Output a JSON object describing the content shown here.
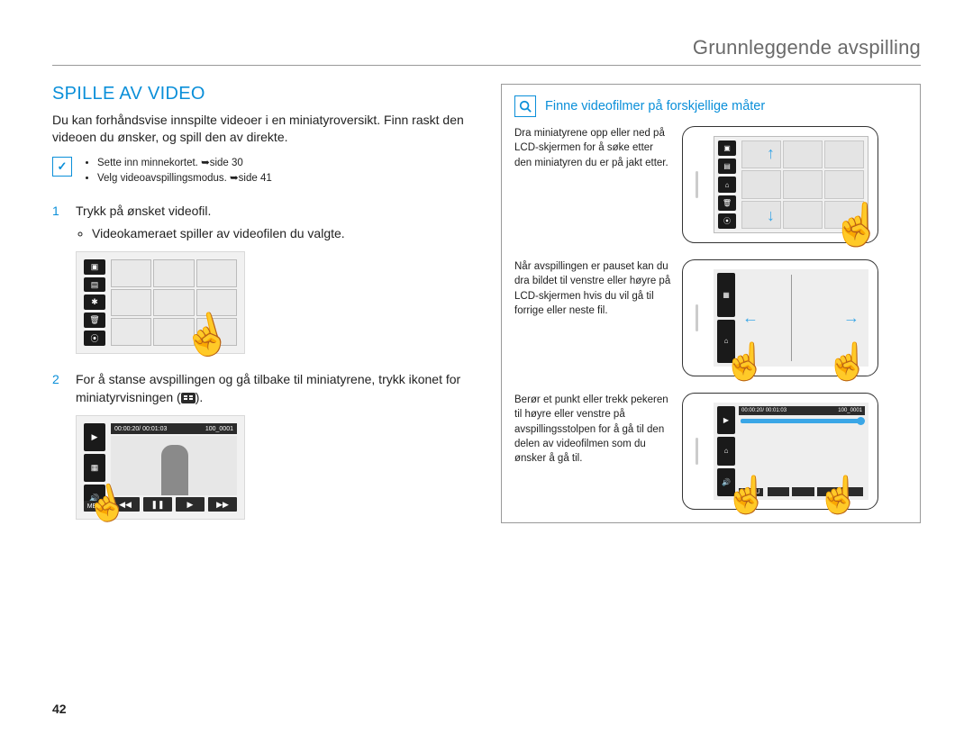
{
  "header": {
    "title": "Grunnleggende avspilling"
  },
  "section": {
    "title": "SPILLE AV VIDEO"
  },
  "intro": "Du kan forhåndsvise innspilte videoer i en miniatyroversikt. Finn raskt den videoen du ønsker, og spill den av direkte.",
  "notes": {
    "items": [
      {
        "pre": "Sette inn minnekortet. ",
        "arrow": "➥",
        "post": "side 30"
      },
      {
        "pre": "Velg videoavspillingsmodus. ",
        "arrow": "➥",
        "post": "side 41"
      }
    ]
  },
  "steps": [
    {
      "num": "1",
      "text": "Trykk på ønsket videofil.",
      "sub": [
        "Videokameraet spiller av videofilen du valgte."
      ]
    },
    {
      "num": "2",
      "text_a": "For å stanse avspillingen og gå tilbake til miniatyrene, trykk ikonet for miniatyrvisningen (",
      "text_b": ")."
    }
  ],
  "player": {
    "time": "00:00:20/ 00:01:03",
    "clip": "100_0001",
    "menu": "MENU",
    "controls": [
      "◀◀",
      "❚❚",
      "▶",
      "▶▶"
    ]
  },
  "sidebar_icons": [
    "▣",
    "▤",
    "✱",
    "🗑",
    "⦿"
  ],
  "info": {
    "title": "Finne videofilmer på forskjellige måter",
    "rows": [
      {
        "text": "Dra miniatyrene opp eller ned på LCD-skjermen for å søke etter den miniatyren du er på jakt etter."
      },
      {
        "text": "Når avspillingen er pauset kan du dra bildet til venstre eller høyre på LCD-skjermen hvis du vil gå til forrige eller neste fil."
      },
      {
        "text": "Berør et punkt eller trekk pekeren til høyre eller venstre på avspillingsstolpen for å gå til den delen av videofilmen som du ønsker å gå til."
      }
    ]
  },
  "page_number": "42"
}
